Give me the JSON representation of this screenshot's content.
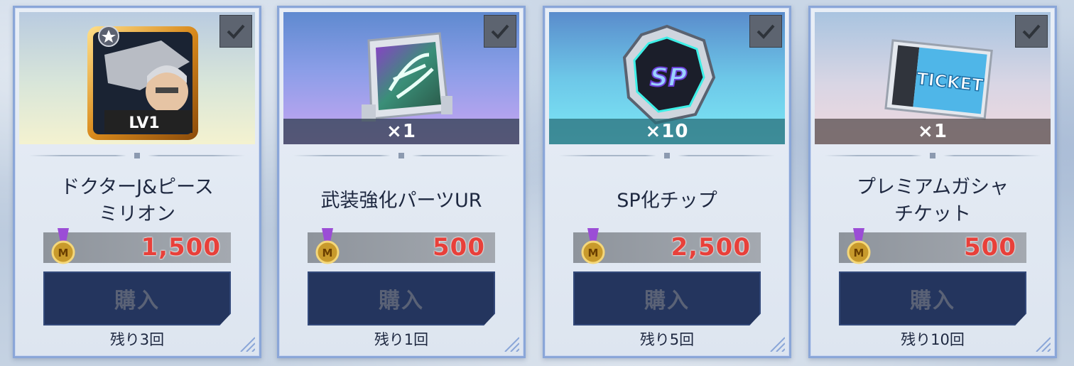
{
  "items": [
    {
      "name": "ドクターJ&ピース\nミリオン",
      "badge": "LV1",
      "quantity": "",
      "price": "1,500",
      "buy_label": "購入",
      "remaining": "残り3回",
      "icon": "character-portrait-icon"
    },
    {
      "name": "武装強化パーツUR",
      "quantity": "×1",
      "price": "500",
      "buy_label": "購入",
      "remaining": "残り1回",
      "icon": "upgrade-parts-icon"
    },
    {
      "name": "SP化チップ",
      "chip_text": "SP",
      "quantity": "×10",
      "price": "2,500",
      "buy_label": "購入",
      "remaining": "残り5回",
      "icon": "sp-chip-icon"
    },
    {
      "name": "プレミアムガシャ\nチケット",
      "ticket_text": "TICKET",
      "quantity": "×1",
      "price": "500",
      "buy_label": "購入",
      "remaining": "残り10回",
      "icon": "ticket-icon"
    }
  ],
  "colors": {
    "price_red": "#e8403a",
    "button_navy": "#24355e",
    "card_border": "#8aa6d8"
  }
}
